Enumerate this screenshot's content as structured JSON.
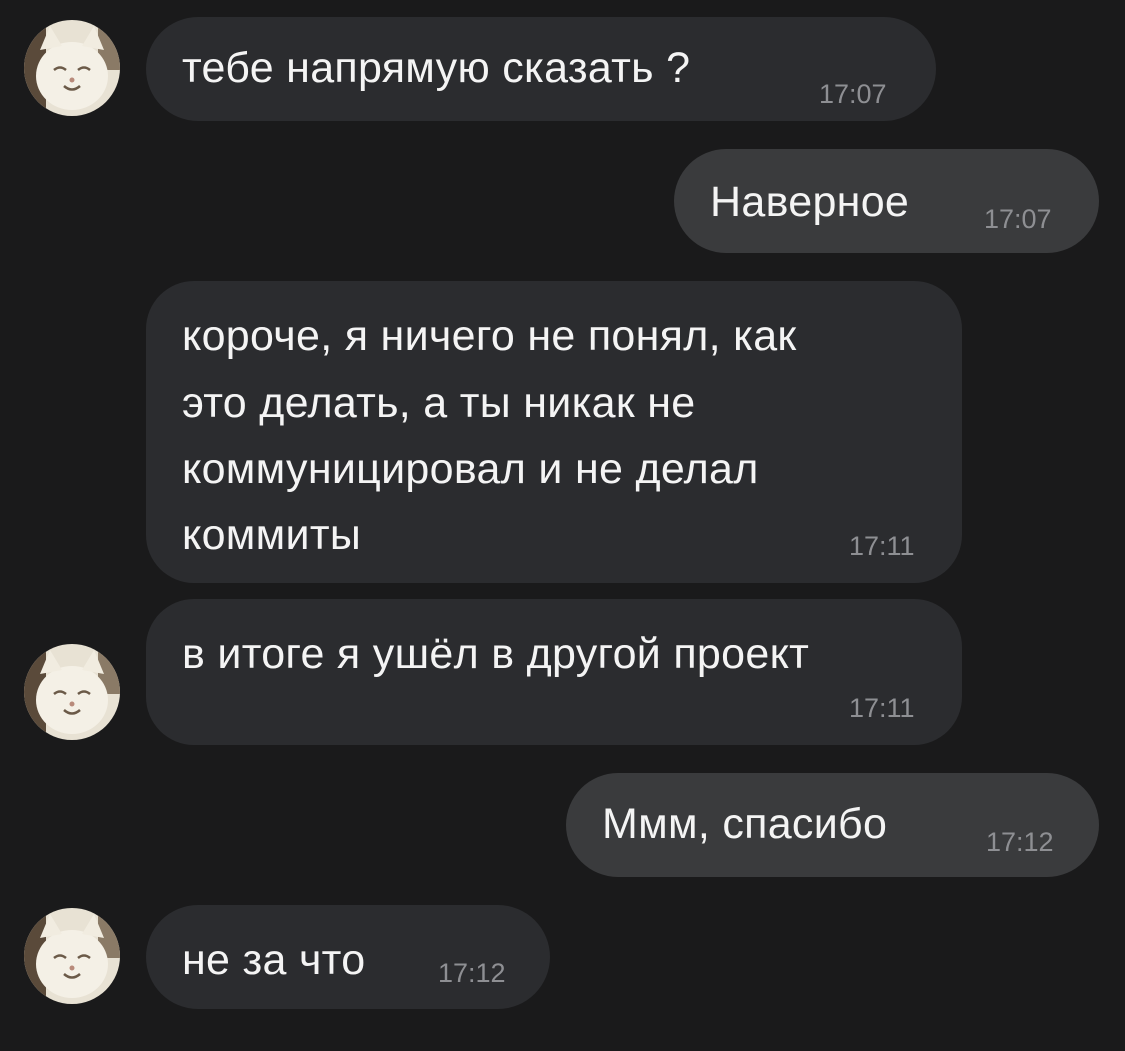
{
  "chat": {
    "messages": [
      {
        "direction": "incoming",
        "lines": [
          "тебе напрямую сказать ?"
        ],
        "time": "17:07",
        "avatar": "cat-avatar"
      },
      {
        "direction": "outgoing",
        "lines": [
          "Наверное"
        ],
        "time": "17:07"
      },
      {
        "direction": "incoming",
        "lines": [
          "короче, я ничего не понял, как",
          "это делать, а ты никак не",
          "коммуницировал и не делал",
          "коммиты"
        ],
        "time": "17:11"
      },
      {
        "direction": "incoming",
        "lines": [
          "в итоге я ушёл в другой проект"
        ],
        "time": "17:11",
        "avatar": "cat-avatar"
      },
      {
        "direction": "outgoing",
        "lines": [
          "Ммм, спасибо"
        ],
        "time": "17:12"
      },
      {
        "direction": "incoming",
        "lines": [
          "не за что"
        ],
        "time": "17:12",
        "avatar": "cat-avatar"
      }
    ]
  },
  "colors": {
    "background": "#1a1a1b",
    "incoming_bubble": "#2b2c2f",
    "outgoing_bubble": "#3a3b3d",
    "text": "#f4f4f4",
    "timestamp": "#8e8f93"
  }
}
